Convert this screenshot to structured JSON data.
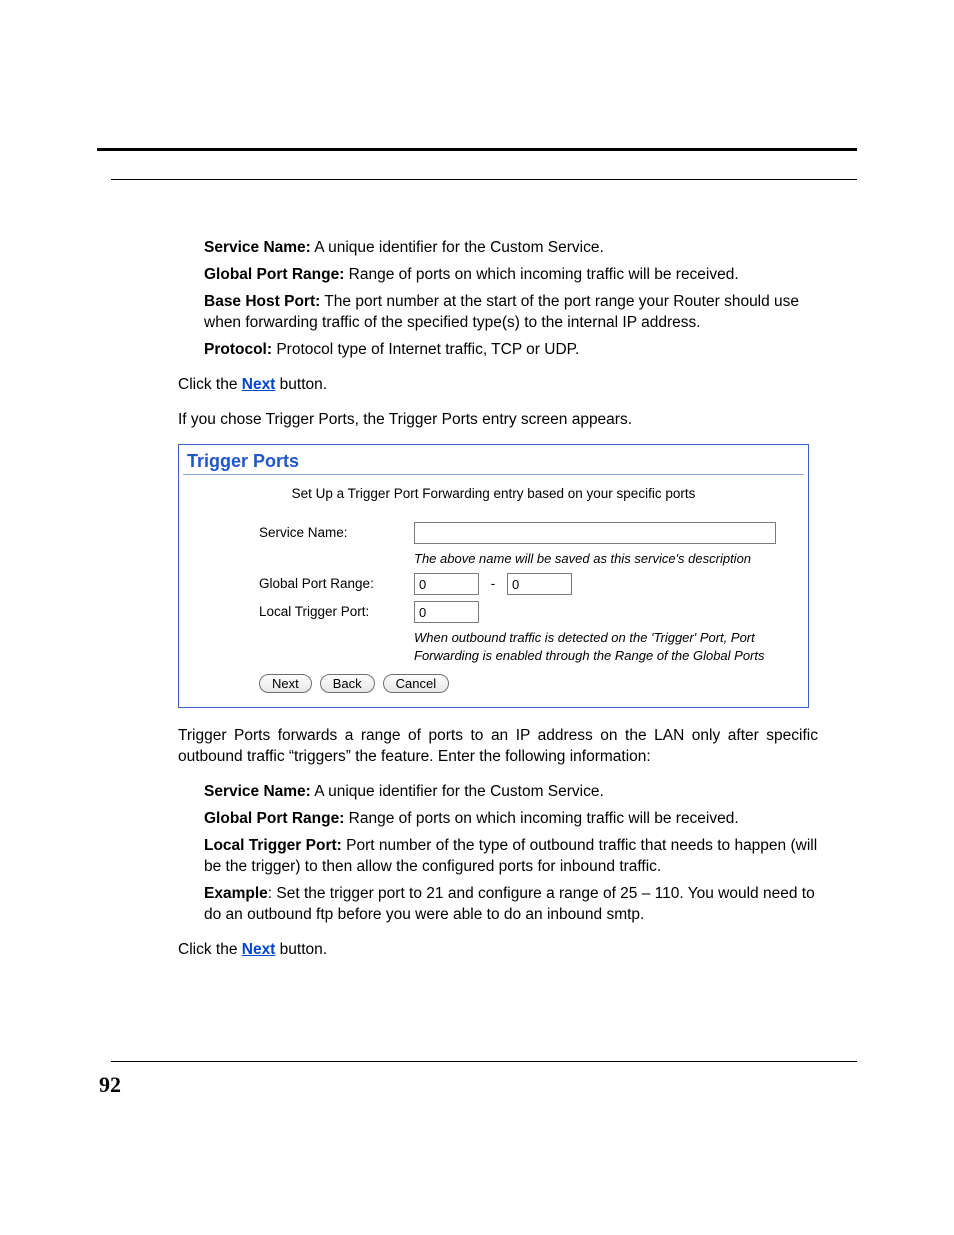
{
  "page_number": "92",
  "top": {
    "service_name_label": "Service Name:",
    "service_name_text": " A unique identifier for the Custom Service.",
    "gpr_label": "Global Port Range:",
    "gpr_text": " Range of ports on which incoming traffic will be received.",
    "bhp_label": "Base Host Port:",
    "bhp_text": " The port number at the start of the port range your Router should use when forwarding traffic of the specified type(s) to the internal IP address.",
    "proto_label": "Protocol:",
    "proto_text": " Protocol type of Internet traffic, TCP or UDP."
  },
  "click1_a": "Click the ",
  "click1_link": "Next",
  "click1_b": " button.",
  "lead2": "If you chose Trigger Ports, the Trigger Ports entry screen appears.",
  "shot": {
    "title": "Trigger Ports",
    "intro": "Set Up a Trigger Port Forwarding entry based on your specific ports",
    "row1_label": "Service Name:",
    "row1_value": "",
    "row1_hint": "The above name will be saved as this service's description",
    "row2_label": "Global Port Range:",
    "row2_from": "0",
    "row2_dash": "-",
    "row2_to": "0",
    "row3_label": "Local Trigger Port:",
    "row3_value": "0",
    "row3_hint": "When outbound traffic is detected on the 'Trigger' Port, Port Forwarding is enabled through the Range of the Global Ports",
    "btn_next": "Next",
    "btn_back": "Back",
    "btn_cancel": "Cancel"
  },
  "para_after": "Trigger Ports forwards a range of ports to an IP address on the LAN only after specific outbound traffic “triggers” the feature. Enter the following information:",
  "bottom": {
    "sn_label": "Service Name:",
    "sn_text": " A unique identifier for the Custom Service.",
    "gpr_label": "Global Port Range:",
    "gpr_text": " Range of ports on which incoming traffic will be received.",
    "ltp_label": "Local Trigger Port:",
    "ltp_text": " Port number of the type of outbound traffic that needs to happen (will be the trigger) to then allow the configured ports for inbound traffic.",
    "ex_label": "Example",
    "ex_text": ": Set the trigger port to 21 and configure a range of 25 – 110. You would need to do an outbound ftp before you were able to do an inbound smtp."
  },
  "click2_a": "Click the ",
  "click2_link": "Next",
  "click2_b": " button."
}
